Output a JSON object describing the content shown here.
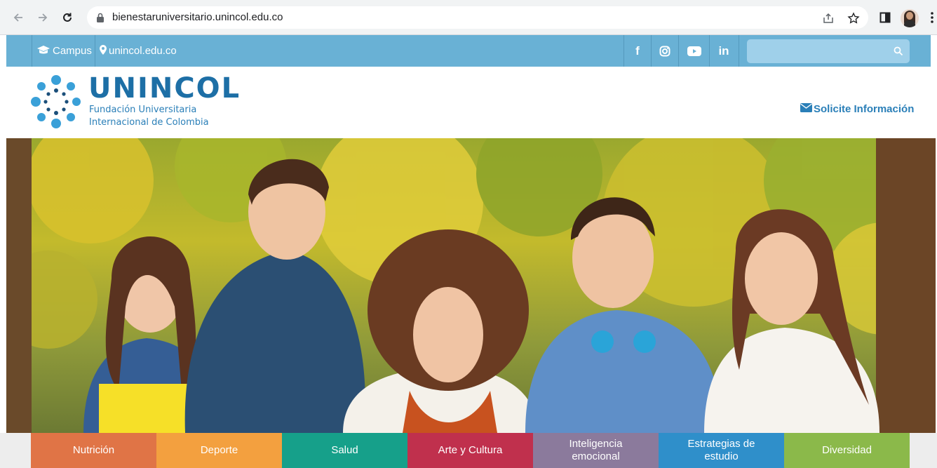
{
  "browser": {
    "url": "bienestaruniversitario.unincol.edu.co",
    "icons": [
      "back-arrow-icon",
      "forward-arrow-icon",
      "reload-icon",
      "lock-icon",
      "share-icon",
      "star-icon",
      "side-panel-icon",
      "profile-avatar",
      "more-menu-icon"
    ]
  },
  "topbar": {
    "campus_label": "Campus",
    "site_label": "unincol.edu.co",
    "social": [
      "f",
      "instagram",
      "youtube",
      "in"
    ],
    "facebook_label": "f",
    "linkedin_label": "in",
    "search_placeholder": ""
  },
  "header": {
    "brand": "UNINCOL",
    "subtitle_line1": "Fundación Universitaria",
    "subtitle_line2": "Internacional de Colombia",
    "info_label": "Solicite Información"
  },
  "nav": {
    "tiles": [
      {
        "label": "Nutrición",
        "color": "#e07446"
      },
      {
        "label": "Deporte",
        "color": "#f3a03f"
      },
      {
        "label": "Salud",
        "color": "#16a08a"
      },
      {
        "label": "Arte y Cultura",
        "color": "#c0304d"
      },
      {
        "label": "Inteligencia emocional",
        "color": "#8b7a9c"
      },
      {
        "label": "Estrategias de estudio",
        "color": "#2f8fca"
      },
      {
        "label": "Diversidad",
        "color": "#8bb94a"
      }
    ]
  },
  "colors": {
    "topbar": "#69b1d5",
    "brand_blue": "#1d6fa6"
  }
}
